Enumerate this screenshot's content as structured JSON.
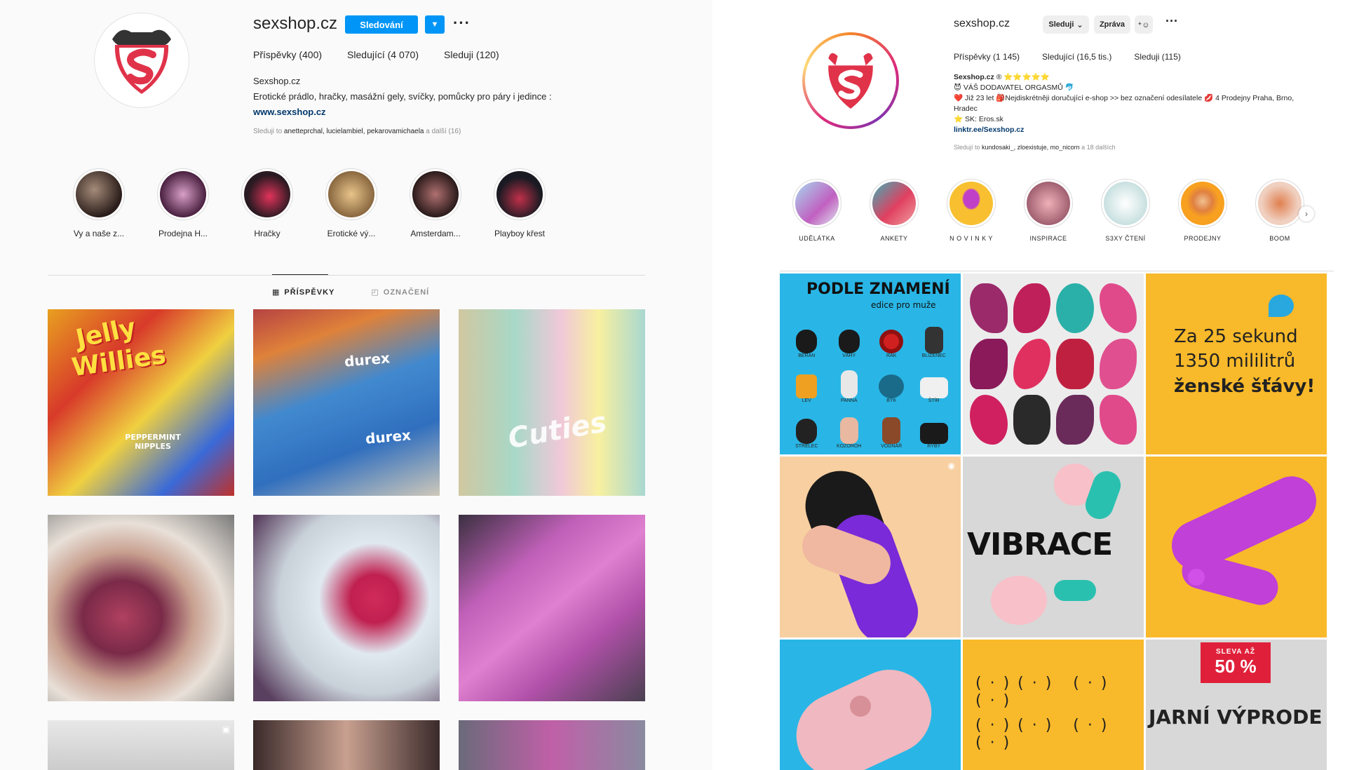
{
  "left_profile": {
    "username": "sexshop.cz",
    "follow_button": "Sledování",
    "dropdown_icon": "caret-down-icon",
    "stats": [
      "Příspěvky (400)",
      "Sledující (4 070)",
      "Sleduji (120)"
    ],
    "bio_name": "Sexshop.cz",
    "bio_text": "Erotické prádlo, hračky, masážní gely, svíčky, pomůcky pro páry i jedince :",
    "bio_link": "www.sexshop.cz",
    "followed_prefix": "Sleduji to",
    "followed_names": "anetteprchal, lucielambiel, pekarovamichaela",
    "followed_suffix": "a další (16)",
    "highlights": [
      {
        "label": "Vy a naše z..."
      },
      {
        "label": "Prodejna H..."
      },
      {
        "label": "Hračky"
      },
      {
        "label": "Erotické vý..."
      },
      {
        "label": "Amsterdam..."
      },
      {
        "label": "Playboy křest"
      }
    ],
    "tabs": [
      {
        "label": "PŘÍSPĚVKY",
        "icon": "grid-icon"
      },
      {
        "label": "OZNAČENÍ",
        "icon": "tag-icon"
      }
    ],
    "posts": [
      {
        "text1": "Jelly",
        "text2": "Willies",
        "text3": "PEPPERMINT NIPPLES"
      },
      {
        "text1": "durex",
        "text2": "durex"
      },
      {
        "text1": "Cuties"
      },
      {
        "text1": ""
      },
      {
        "text1": ""
      },
      {
        "text1": ""
      },
      {
        "text1": ""
      },
      {
        "text1": ""
      },
      {
        "text1": ""
      }
    ]
  },
  "right_profile": {
    "username": "sexshop.cz",
    "following_button": "Sleduji",
    "message_button": "Zpráva",
    "add_person_icon": "add-person-icon",
    "stats": [
      "Příspěvky (1 145)",
      "Sledující (16,5 tis.)",
      "Sleduji (115)"
    ],
    "bio_name": "Sexshop.cz",
    "bio_stars": "® ⭐⭐⭐⭐⭐",
    "bio_lines": [
      "😈 VÁŠ DODAVATEL ORGASMŮ 🐬",
      "❤️ Již 23 let 🎒Nejdiskrétněji doručující e-shop >> bez označení odesílatele 💋 4 Prodejny Praha, Brno, Hradec",
      "⭐ SK: Eros.sk"
    ],
    "bio_link": "linktr.ee/Sexshop.cz",
    "followed_prefix": "Sledují to",
    "followed_names": "kundosaki_, zloexistuje, mo_nicorn",
    "followed_suffix": "a 18 dalších",
    "highlights": [
      {
        "label": "UDĚLÁTKA"
      },
      {
        "label": "ANKETY"
      },
      {
        "label": "N O V I N K Y"
      },
      {
        "label": "INSPIRACE"
      },
      {
        "label": "S3XY ČTENÍ"
      },
      {
        "label": "PRODEJNY"
      },
      {
        "label": "BOOM"
      }
    ],
    "posts": [
      {
        "title": "PODLE ZNAMENÍ",
        "subtitle": "edice pro muže",
        "labels": [
          "BERAN",
          "VÁHY",
          "RAK",
          "BLÍŽENEC",
          "LEV",
          "PANNA",
          "BÝK",
          "ŠTÍR",
          "STŘELEC",
          "KOZOROH",
          "VODNÁŘ",
          "RYBY"
        ]
      },
      {
        "title": ""
      },
      {
        "line1": "Za 25 sekund",
        "line2": "1350 mililitrů",
        "line3": "ženské šťávy!"
      },
      {
        "title": ""
      },
      {
        "title": "VIBRACE"
      },
      {
        "title": ""
      },
      {
        "title": ""
      },
      {
        "title": ""
      },
      {
        "badge1": "SLEVA AŽ",
        "badge2": "50 %",
        "title": "JARNÍ VÝPRODE"
      }
    ]
  },
  "colors": {
    "brand_red": "#e0334a",
    "ig_blue": "#0095f6",
    "link_blue": "#00376b",
    "muted": "#8e8e8e"
  }
}
